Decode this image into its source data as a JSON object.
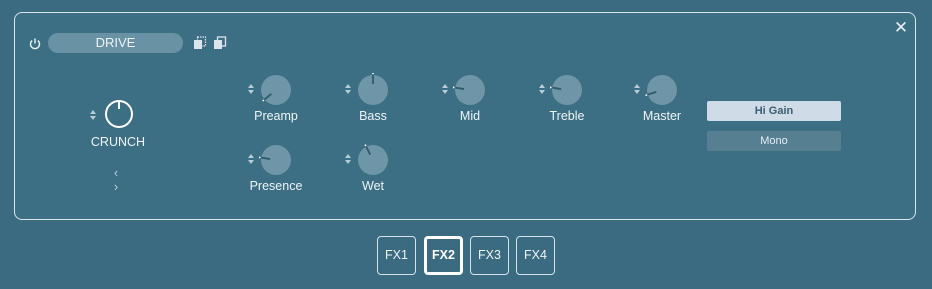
{
  "effect": {
    "name": "DRIVE",
    "preset": "CRUNCH"
  },
  "icons": {
    "power": "power-icon",
    "copy": "copy-icon",
    "paste": "paste-icon",
    "close": "close-icon",
    "prev": "chevron-left-icon",
    "next": "chevron-right-icon"
  },
  "prev_next": "‹ ›",
  "close_glyph": "✕",
  "knobs": {
    "preamp": {
      "label": "Preamp",
      "level": 0.02
    },
    "bass": {
      "label": "Bass",
      "level": 0.5
    },
    "mid": {
      "label": "Mid",
      "level": 0.2
    },
    "treble": {
      "label": "Treble",
      "level": 0.2
    },
    "master": {
      "label": "Master",
      "level": 0.1
    },
    "presence": {
      "label": "Presence",
      "level": 0.2
    },
    "wet": {
      "label": "Wet",
      "level": 0.4
    }
  },
  "buttons": {
    "hi_gain": "Hi Gain",
    "mono": "Mono"
  },
  "tabs": [
    {
      "label": "FX1",
      "active": false
    },
    {
      "label": "FX2",
      "active": true
    },
    {
      "label": "FX3",
      "active": false
    },
    {
      "label": "FX4",
      "active": false
    }
  ],
  "colors": {
    "background": "#3a6b80",
    "knob_fill": "#6f95a8",
    "active_button": "#cfdbe6"
  }
}
